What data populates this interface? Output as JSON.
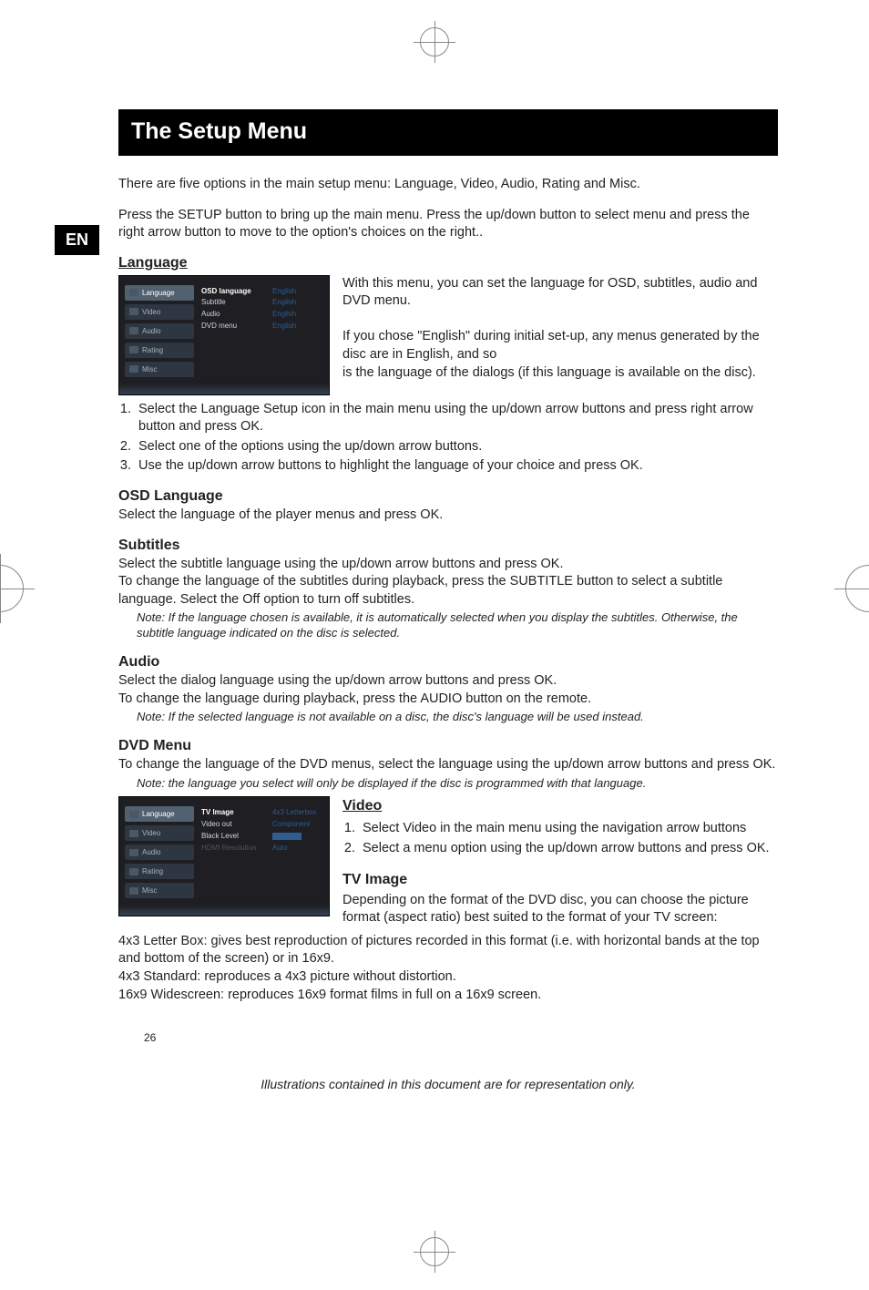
{
  "locale_badge": "EN",
  "title": "The Setup Menu",
  "intro1": "There are five options in the main setup menu: Language, Video, Audio, Rating and Misc.",
  "intro2": "Press the SETUP button to bring up the main menu. Press the up/down button to select menu and press the right arrow button to move to the option's choices on the right..",
  "language": {
    "heading": "Language",
    "p1": "With this menu, you can set the language for OSD, subtitles, audio and DVD menu.",
    "p2a": "If you chose \"English\" during initial set-up, any menus generated by the disc are in English, and so",
    "p2b": "is the language of the dialogs (if this language is available on the disc).",
    "steps": [
      "Select the Language Setup icon in the main menu using the up/down arrow buttons and press right arrow button and press OK.",
      "Select one of the options using the up/down arrow buttons.",
      "Use the up/down arrow buttons to highlight the language of your choice and press OK."
    ],
    "menu_tabs": [
      "Language",
      "Video",
      "Audio",
      "Rating",
      "Misc"
    ],
    "menu_mid": [
      "OSD language",
      "Subtitle",
      "Audio",
      "DVD menu"
    ],
    "menu_right": [
      "English",
      "English",
      "English",
      "English"
    ]
  },
  "osd": {
    "heading": "OSD Language",
    "body": "Select the language of the player menus and press OK."
  },
  "subtitles": {
    "heading": "Subtitles",
    "p1": "Select the subtitle language using the up/down arrow buttons and press OK.",
    "p2": "To change the language of the subtitles during playback, press the SUBTITLE button to select a subtitle language. Select the Off option to turn off subtitles.",
    "note": "Note: If the language chosen is available, it is automatically selected when you display the subtitles. Otherwise, the subtitle language indicated on the disc is selected."
  },
  "audio": {
    "heading": "Audio",
    "p1": "Select the dialog language using the up/down arrow buttons and press OK.",
    "p2": "To change the language during playback, press the AUDIO button on the remote.",
    "note": "Note: If the selected language is not available on a disc, the disc's language will be used instead."
  },
  "dvdmenu": {
    "heading": "DVD Menu",
    "p1": "To change the language of the DVD menus, select the language using the up/down arrow buttons and press OK.",
    "note": "Note: the language you select will only be displayed if the disc is programmed with that language."
  },
  "video": {
    "heading": "Video",
    "steps": [
      "Select Video in the main menu using the navigation arrow buttons",
      "Select a menu option using the up/down arrow buttons and press OK."
    ],
    "menu_mid": [
      "TV Image",
      "Video out",
      "Black Level",
      "HDMI Resolution"
    ],
    "menu_right": [
      "4x3 Letterbox",
      "Component",
      "",
      "Auto"
    ]
  },
  "tvimage": {
    "heading": "TV Image",
    "p1": "Depending on the format of the DVD disc, you can choose the picture format (aspect ratio) best suited to the format of your TV screen:",
    "p2": "4x3 Letter Box: gives best reproduction of pictures recorded in this format (i.e. with horizontal bands at the top and bottom of the screen) or in 16x9.",
    "p3": "4x3 Standard: reproduces a 4x3 picture without distortion.",
    "p4": "16x9 Widescreen: reproduces 16x9 format films in full on a 16x9 screen."
  },
  "footer": "Illustrations contained in this document are for representation only.",
  "page_number": "26"
}
